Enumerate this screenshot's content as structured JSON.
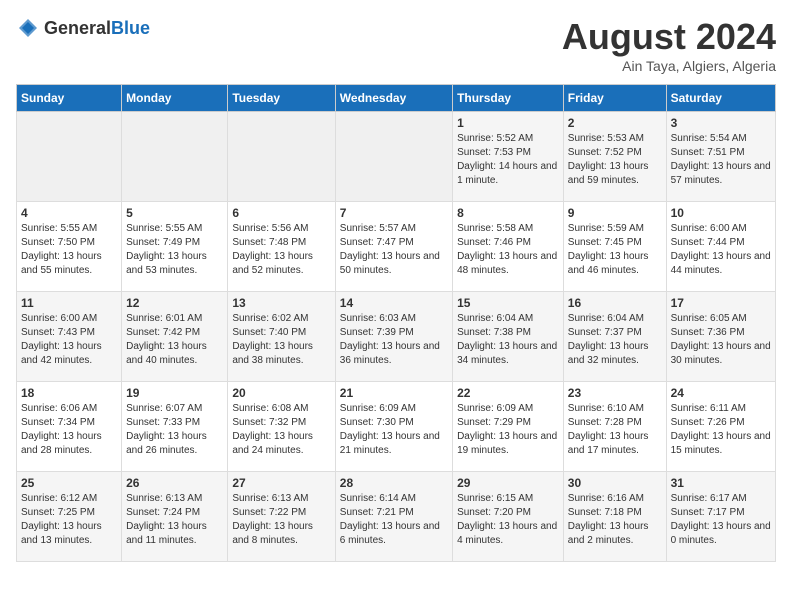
{
  "header": {
    "logo_general": "General",
    "logo_blue": "Blue",
    "title": "August 2024",
    "subtitle": "Ain Taya, Algiers, Algeria"
  },
  "calendar": {
    "days_of_week": [
      "Sunday",
      "Monday",
      "Tuesday",
      "Wednesday",
      "Thursday",
      "Friday",
      "Saturday"
    ],
    "weeks": [
      [
        {
          "day": "",
          "info": ""
        },
        {
          "day": "",
          "info": ""
        },
        {
          "day": "",
          "info": ""
        },
        {
          "day": "",
          "info": ""
        },
        {
          "day": "1",
          "info": "Sunrise: 5:52 AM\nSunset: 7:53 PM\nDaylight: 14 hours and 1 minute."
        },
        {
          "day": "2",
          "info": "Sunrise: 5:53 AM\nSunset: 7:52 PM\nDaylight: 13 hours and 59 minutes."
        },
        {
          "day": "3",
          "info": "Sunrise: 5:54 AM\nSunset: 7:51 PM\nDaylight: 13 hours and 57 minutes."
        }
      ],
      [
        {
          "day": "4",
          "info": "Sunrise: 5:55 AM\nSunset: 7:50 PM\nDaylight: 13 hours and 55 minutes."
        },
        {
          "day": "5",
          "info": "Sunrise: 5:55 AM\nSunset: 7:49 PM\nDaylight: 13 hours and 53 minutes."
        },
        {
          "day": "6",
          "info": "Sunrise: 5:56 AM\nSunset: 7:48 PM\nDaylight: 13 hours and 52 minutes."
        },
        {
          "day": "7",
          "info": "Sunrise: 5:57 AM\nSunset: 7:47 PM\nDaylight: 13 hours and 50 minutes."
        },
        {
          "day": "8",
          "info": "Sunrise: 5:58 AM\nSunset: 7:46 PM\nDaylight: 13 hours and 48 minutes."
        },
        {
          "day": "9",
          "info": "Sunrise: 5:59 AM\nSunset: 7:45 PM\nDaylight: 13 hours and 46 minutes."
        },
        {
          "day": "10",
          "info": "Sunrise: 6:00 AM\nSunset: 7:44 PM\nDaylight: 13 hours and 44 minutes."
        }
      ],
      [
        {
          "day": "11",
          "info": "Sunrise: 6:00 AM\nSunset: 7:43 PM\nDaylight: 13 hours and 42 minutes."
        },
        {
          "day": "12",
          "info": "Sunrise: 6:01 AM\nSunset: 7:42 PM\nDaylight: 13 hours and 40 minutes."
        },
        {
          "day": "13",
          "info": "Sunrise: 6:02 AM\nSunset: 7:40 PM\nDaylight: 13 hours and 38 minutes."
        },
        {
          "day": "14",
          "info": "Sunrise: 6:03 AM\nSunset: 7:39 PM\nDaylight: 13 hours and 36 minutes."
        },
        {
          "day": "15",
          "info": "Sunrise: 6:04 AM\nSunset: 7:38 PM\nDaylight: 13 hours and 34 minutes."
        },
        {
          "day": "16",
          "info": "Sunrise: 6:04 AM\nSunset: 7:37 PM\nDaylight: 13 hours and 32 minutes."
        },
        {
          "day": "17",
          "info": "Sunrise: 6:05 AM\nSunset: 7:36 PM\nDaylight: 13 hours and 30 minutes."
        }
      ],
      [
        {
          "day": "18",
          "info": "Sunrise: 6:06 AM\nSunset: 7:34 PM\nDaylight: 13 hours and 28 minutes."
        },
        {
          "day": "19",
          "info": "Sunrise: 6:07 AM\nSunset: 7:33 PM\nDaylight: 13 hours and 26 minutes."
        },
        {
          "day": "20",
          "info": "Sunrise: 6:08 AM\nSunset: 7:32 PM\nDaylight: 13 hours and 24 minutes."
        },
        {
          "day": "21",
          "info": "Sunrise: 6:09 AM\nSunset: 7:30 PM\nDaylight: 13 hours and 21 minutes."
        },
        {
          "day": "22",
          "info": "Sunrise: 6:09 AM\nSunset: 7:29 PM\nDaylight: 13 hours and 19 minutes."
        },
        {
          "day": "23",
          "info": "Sunrise: 6:10 AM\nSunset: 7:28 PM\nDaylight: 13 hours and 17 minutes."
        },
        {
          "day": "24",
          "info": "Sunrise: 6:11 AM\nSunset: 7:26 PM\nDaylight: 13 hours and 15 minutes."
        }
      ],
      [
        {
          "day": "25",
          "info": "Sunrise: 6:12 AM\nSunset: 7:25 PM\nDaylight: 13 hours and 13 minutes."
        },
        {
          "day": "26",
          "info": "Sunrise: 6:13 AM\nSunset: 7:24 PM\nDaylight: 13 hours and 11 minutes."
        },
        {
          "day": "27",
          "info": "Sunrise: 6:13 AM\nSunset: 7:22 PM\nDaylight: 13 hours and 8 minutes."
        },
        {
          "day": "28",
          "info": "Sunrise: 6:14 AM\nSunset: 7:21 PM\nDaylight: 13 hours and 6 minutes."
        },
        {
          "day": "29",
          "info": "Sunrise: 6:15 AM\nSunset: 7:20 PM\nDaylight: 13 hours and 4 minutes."
        },
        {
          "day": "30",
          "info": "Sunrise: 6:16 AM\nSunset: 7:18 PM\nDaylight: 13 hours and 2 minutes."
        },
        {
          "day": "31",
          "info": "Sunrise: 6:17 AM\nSunset: 7:17 PM\nDaylight: 13 hours and 0 minutes."
        }
      ]
    ]
  }
}
